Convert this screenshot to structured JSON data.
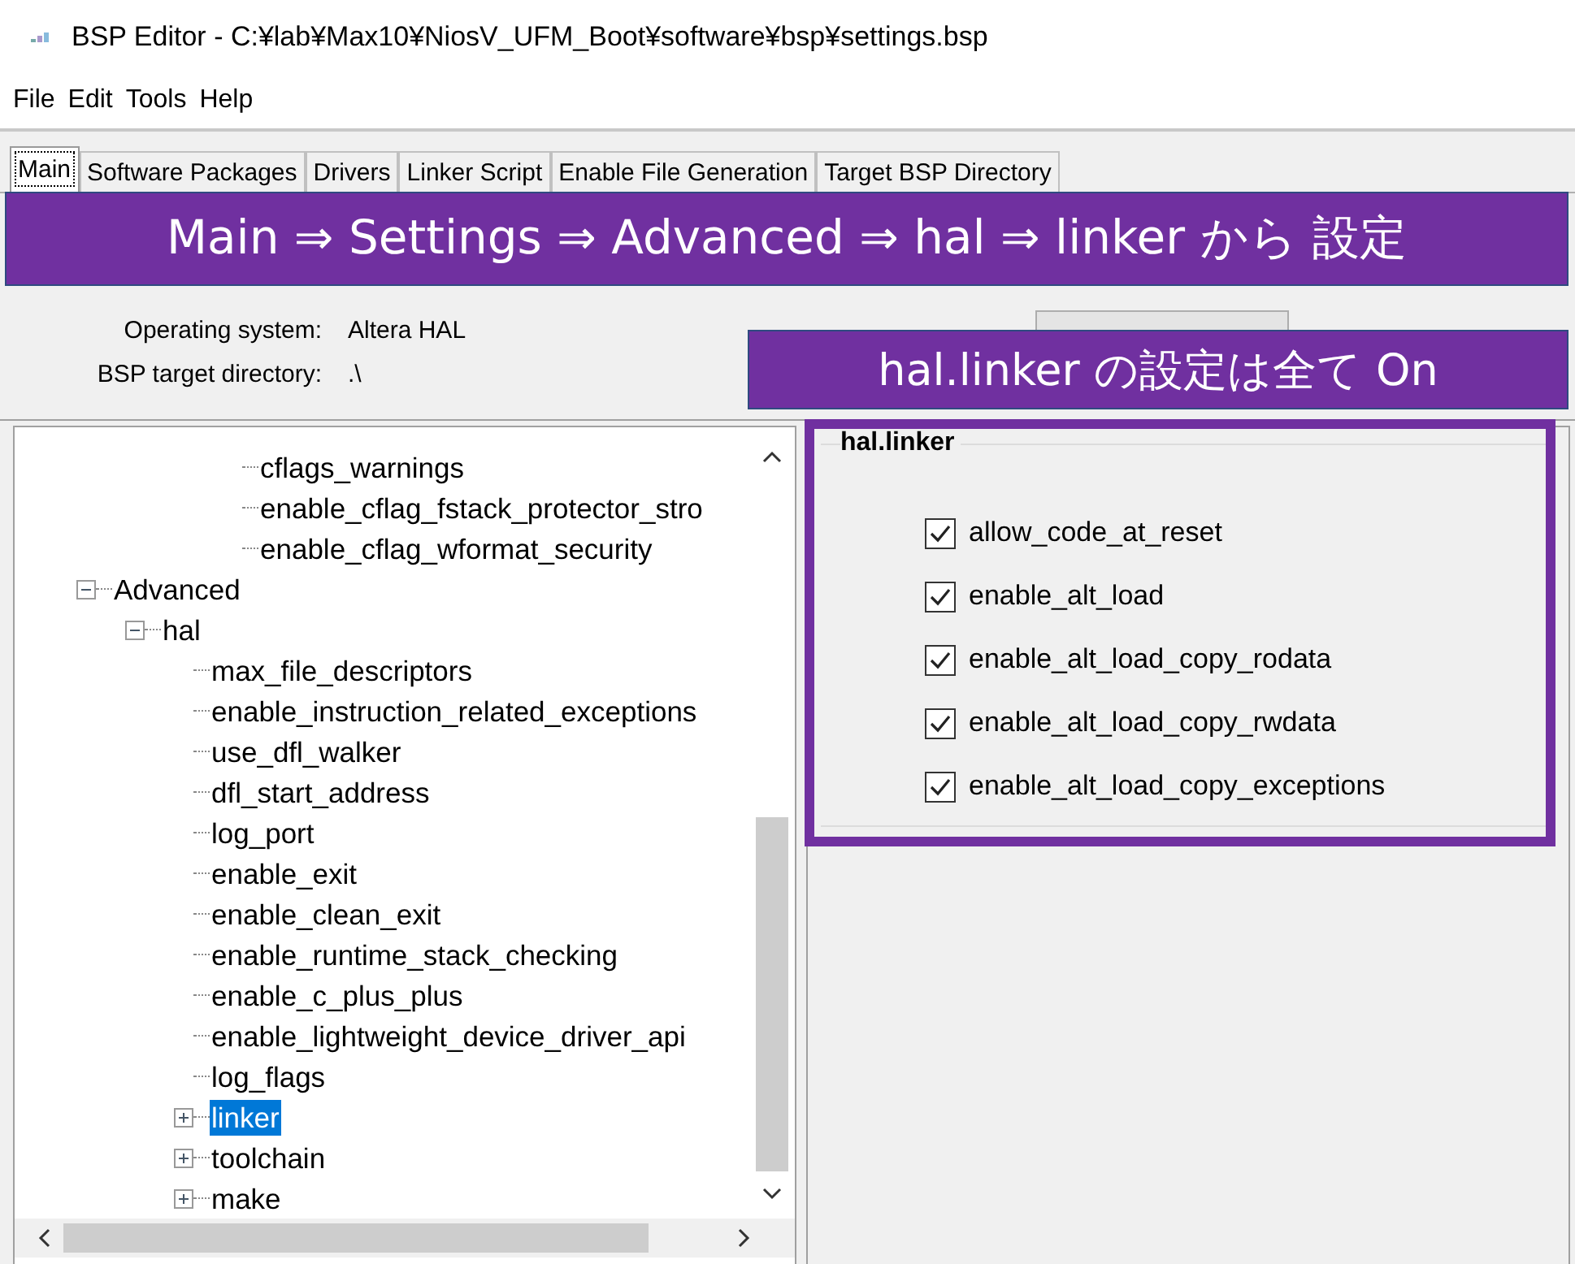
{
  "window": {
    "title": "BSP Editor - C:¥lab¥Max10¥NiosV_UFM_Boot¥software¥bsp¥settings.bsp"
  },
  "menu": [
    "File",
    "Edit",
    "Tools",
    "Help"
  ],
  "tabs": [
    {
      "label": "Main",
      "selected": true
    },
    {
      "label": "Software Packages",
      "selected": false
    },
    {
      "label": "Drivers",
      "selected": false
    },
    {
      "label": "Linker Script",
      "selected": false
    },
    {
      "label": "Enable File Generation",
      "selected": false
    },
    {
      "label": "Target BSP Directory",
      "selected": false
    }
  ],
  "info": [
    {
      "label": "Operating system:",
      "value": "Altera HAL"
    },
    {
      "label": "BSP target directory:",
      "value": ".\\"
    }
  ],
  "tree": {
    "items": [
      {
        "children": [
          {
            "children": [
              {
                "children": [
                  {
                    "label": "cflags_warnings",
                    "selected": false
                  },
                  {
                    "label": "enable_cflag_fstack_protector_stro",
                    "selected": false
                  },
                  {
                    "label": "enable_cflag_wformat_security",
                    "selected": false
                  }
                ]
              }
            ]
          }
        ]
      },
      {
        "label": "Advanced",
        "selected": false,
        "expanded": true,
        "children": [
          {
            "label": "hal",
            "selected": false,
            "expanded": true,
            "children": [
              {
                "label": "max_file_descriptors",
                "selected": false
              },
              {
                "label": "enable_instruction_related_exceptions",
                "selected": false
              },
              {
                "label": "use_dfl_walker",
                "selected": false
              },
              {
                "label": "dfl_start_address",
                "selected": false
              },
              {
                "label": "log_port",
                "selected": false
              },
              {
                "label": "enable_exit",
                "selected": false
              },
              {
                "label": "enable_clean_exit",
                "selected": false
              },
              {
                "label": "enable_runtime_stack_checking",
                "selected": false
              },
              {
                "label": "enable_c_plus_plus",
                "selected": false
              },
              {
                "label": "enable_lightweight_device_driver_api",
                "selected": false
              },
              {
                "label": "log_flags",
                "selected": false
              },
              {
                "label": "linker",
                "selected": true,
                "expanded": false
              },
              {
                "label": "toolchain",
                "selected": false,
                "expanded": false
              },
              {
                "label": "make",
                "selected": false,
                "expanded": false
              }
            ]
          }
        ]
      }
    ]
  },
  "group": {
    "title": "hal.linker",
    "options": [
      {
        "label": "allow_code_at_reset",
        "checked": true
      },
      {
        "label": "enable_alt_load",
        "checked": true
      },
      {
        "label": "enable_alt_load_copy_rodata",
        "checked": true
      },
      {
        "label": "enable_alt_load_copy_rwdata",
        "checked": true
      },
      {
        "label": "enable_alt_load_copy_exceptions",
        "checked": true
      }
    ]
  },
  "annotations": [
    {
      "text": "Main ⇒ Settings ⇒ Advanced ⇒ hal ⇒ linker から 設定",
      "kind": "wide"
    },
    {
      "text": "hal.linker の設定は全て On",
      "kind": "narrow"
    },
    {
      "kind": "frame"
    }
  ]
}
